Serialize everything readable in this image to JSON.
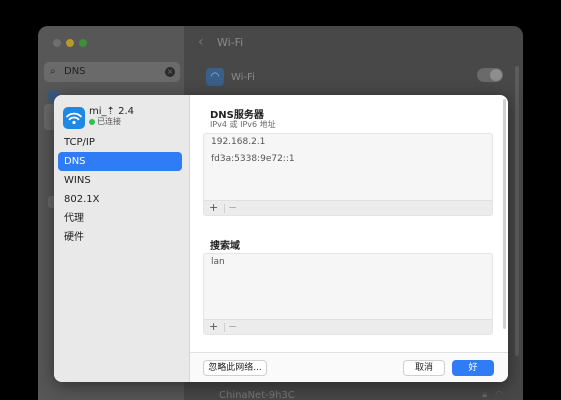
{
  "background": {
    "search": {
      "value": "DNS"
    },
    "header": {
      "title": "Wi-Fi"
    },
    "wifi_row": {
      "label": "Wi-Fi"
    },
    "network_row": {
      "name": "ChinaNet-9h3C"
    }
  },
  "sheet": {
    "network": {
      "name": "mi_⇡ 2.4",
      "status": "已连接"
    },
    "menu": [
      {
        "label": "TCP/IP",
        "selected": false
      },
      {
        "label": "DNS",
        "selected": true
      },
      {
        "label": "WINS",
        "selected": false
      },
      {
        "label": "802.1X",
        "selected": false
      },
      {
        "label": "代理",
        "selected": false
      },
      {
        "label": "硬件",
        "selected": false
      }
    ],
    "dns": {
      "title": "DNS服务器",
      "subtitle": "IPv4 或 IPv6 地址",
      "servers": [
        "192.168.2.1",
        "fd3a:5338:9e72::1"
      ]
    },
    "search_domains": {
      "title": "搜索域",
      "domains": [
        "lan"
      ]
    },
    "controls": {
      "add": "+",
      "remove": "−"
    },
    "buttons": {
      "forget": "忽略此网络...",
      "cancel": "取消",
      "ok": "好"
    }
  },
  "colors": {
    "accent": "#2f7cf6",
    "connected": "#2fc24a",
    "wifi_icon": "#1e88e5"
  }
}
